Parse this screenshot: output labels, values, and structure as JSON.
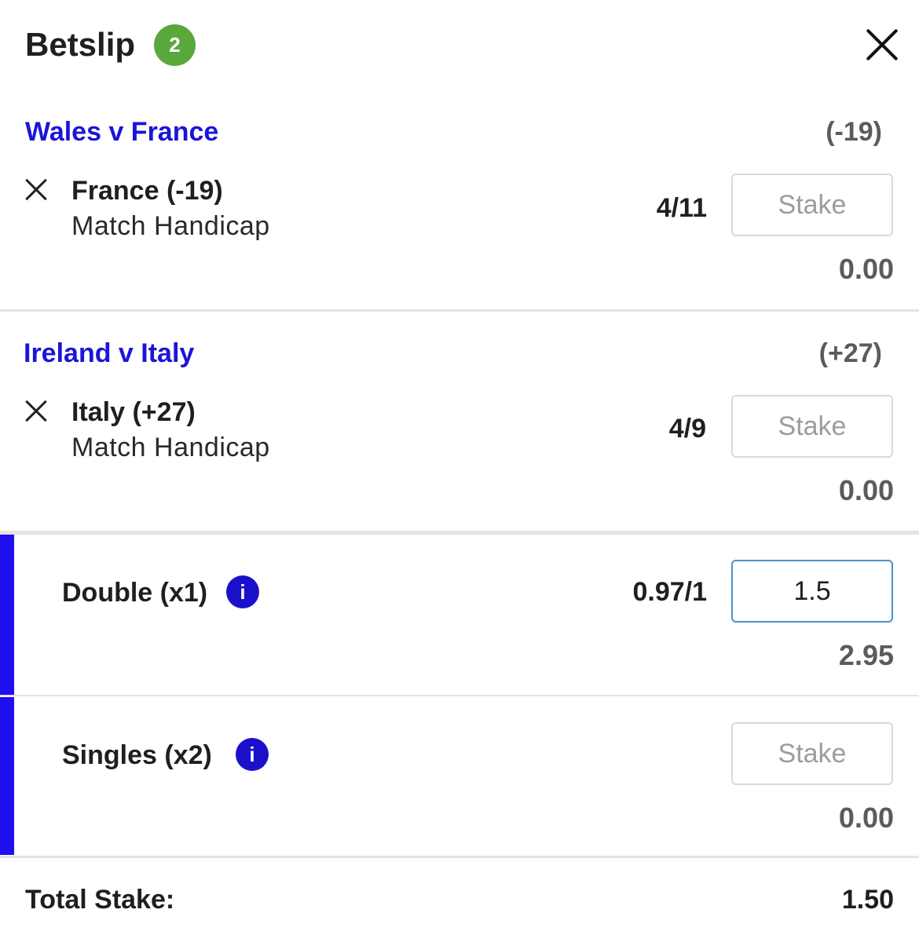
{
  "header": {
    "title": "Betslip",
    "count": "2"
  },
  "bets": [
    {
      "event": "Wales v France",
      "handicap": "(-19)",
      "selection": "France (-19)",
      "market": "Match Handicap",
      "odds": "4/11",
      "stake_placeholder": "Stake",
      "returns": "0.00"
    },
    {
      "event": "Ireland v Italy",
      "handicap": "(+27)",
      "selection": "Italy (+27)",
      "market": "Match Handicap",
      "odds": "4/9",
      "stake_placeholder": "Stake",
      "returns": "0.00"
    }
  ],
  "multiples": [
    {
      "label": "Double (x1)",
      "info": "i",
      "odds": "0.97/1",
      "stake_value": "1.5",
      "returns": "2.95"
    },
    {
      "label": "Singles (x2)",
      "info": "i",
      "stake_placeholder": "Stake",
      "returns": "0.00"
    }
  ],
  "footer": {
    "total_label": "Total Stake:",
    "total_value": "1.50"
  },
  "colors": {
    "accent": "#1e0ef0",
    "event_link": "#1b14d8",
    "badge": "#5aa83c",
    "info_icon": "#1b10c9"
  }
}
